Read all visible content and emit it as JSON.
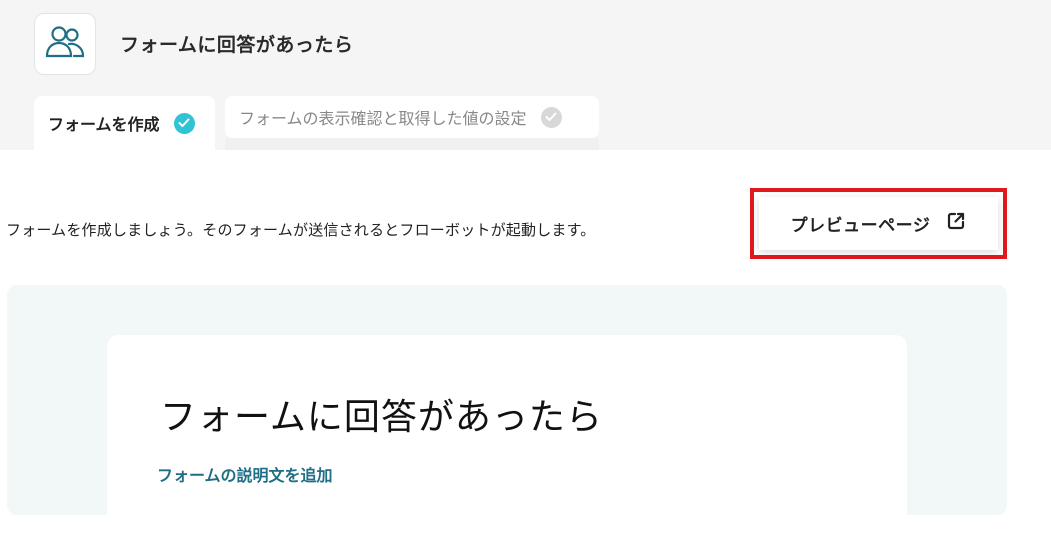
{
  "header": {
    "title": "フォームに回答があったら",
    "app_icon": "users-icon"
  },
  "tabs": [
    {
      "label": "フォームを作成",
      "state": "completed",
      "icon": "check-icon"
    },
    {
      "label": "フォームの表示確認と取得した値の設定",
      "state": "pending",
      "icon": "check-icon"
    }
  ],
  "main": {
    "intro_text": "フォームを作成しましょう。そのフォームが送信されるとフローボットが起動します。",
    "preview_button_label": "プレビューページ",
    "preview_button_icon": "external-link-icon"
  },
  "form": {
    "title": "フォームに回答があったら",
    "add_description_label": "フォームの説明文を追加"
  },
  "colors": {
    "accent": "#2ec4d6",
    "highlight_border": "#e0191e",
    "link": "#1f6e86",
    "form_bg": "#f1f8f7"
  }
}
